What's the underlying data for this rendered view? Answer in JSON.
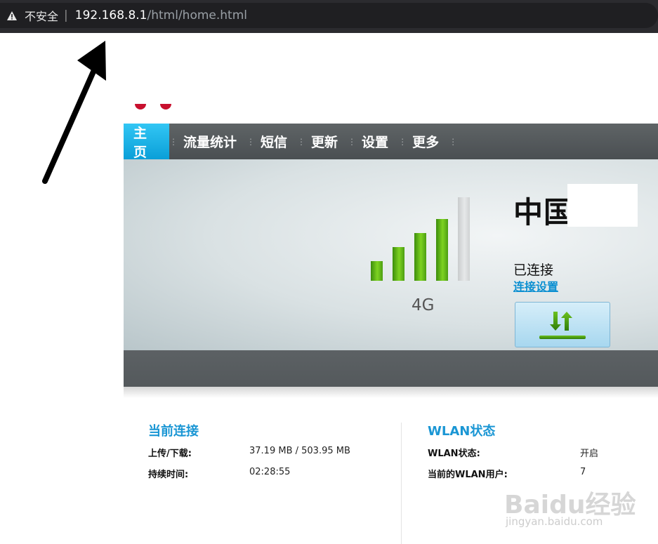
{
  "browser": {
    "security_label": "不安全",
    "separator": "|",
    "url_host": "192.168.8.1",
    "url_path": "/html/home.html",
    "warning_icon": "warning-triangle-icon"
  },
  "nav": {
    "items": [
      {
        "label": "主页",
        "active": true
      },
      {
        "label": "流量统计",
        "active": false
      },
      {
        "label": "短信",
        "active": false
      },
      {
        "label": "更新",
        "active": false
      },
      {
        "label": "设置",
        "active": false
      },
      {
        "label": "更多",
        "active": false
      }
    ],
    "active_color": "#1aaee8"
  },
  "status": {
    "signal_bars_total": 5,
    "signal_bars_lit": 4,
    "network_type": "4G",
    "carrier": "中国",
    "connection_state": "已连接",
    "connection_settings_link": "连接设置",
    "connect_button_icon": "upload-download-arrows-icon"
  },
  "current_connection": {
    "title": "当前连接",
    "rows": [
      {
        "label": "上传/下载:",
        "value": "37.19 MB / 503.95 MB"
      },
      {
        "label": "持续时间:",
        "value": "02:28:55"
      }
    ]
  },
  "wlan_status": {
    "title": "WLAN状态",
    "rows": [
      {
        "label": "WLAN状态:",
        "value": "开启"
      },
      {
        "label": "当前的WLAN用户:",
        "value": "7"
      }
    ]
  },
  "watermark": {
    "text": "Baidu经验",
    "sub": "jingyan.baidu.com"
  }
}
